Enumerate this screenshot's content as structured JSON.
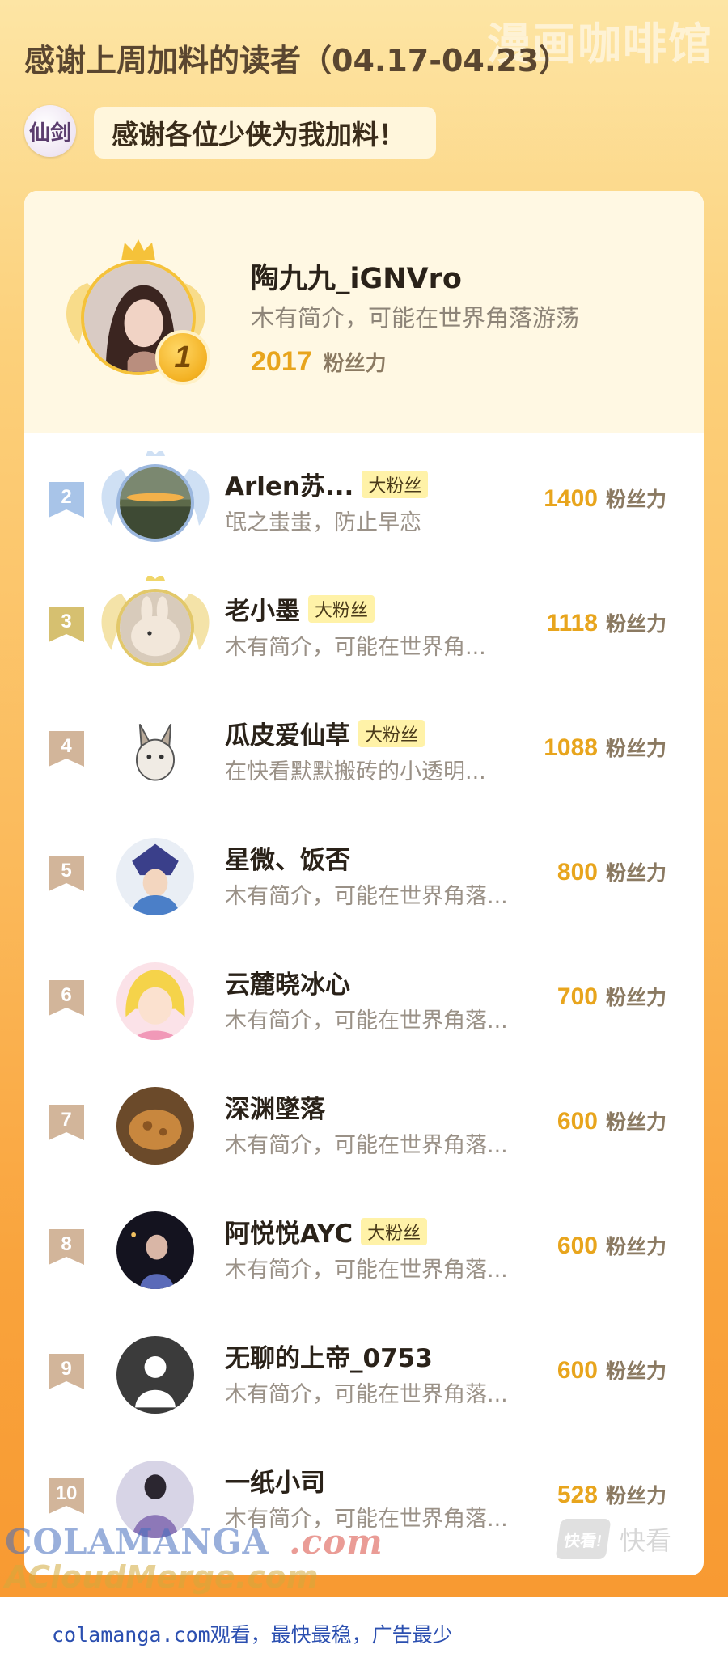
{
  "header": {
    "watermark": "漫画咖啡馆",
    "title": "感谢上周加料的读者（04.17-04.23）",
    "greeting": "感谢各位少侠为我加料！",
    "logo_text": "仙剑"
  },
  "top_reader": {
    "rank": "1",
    "name": "陶九九_iGNVro",
    "intro": "木有简介，可能在世界角落游荡",
    "score": "2017",
    "unit": "粉丝力"
  },
  "readers": [
    {
      "rank": "2",
      "name": "Arlen苏...",
      "badge": "大粉丝",
      "intro": "氓之蚩蚩，防止早恋",
      "score": "1400",
      "unit": "粉丝力"
    },
    {
      "rank": "3",
      "name": "老小墨",
      "badge": "大粉丝",
      "intro": "木有简介，可能在世界角...",
      "score": "1118",
      "unit": "粉丝力"
    },
    {
      "rank": "4",
      "name": "瓜皮爱仙草",
      "badge": "大粉丝",
      "intro": "在快看默默搬砖的小透明...",
      "score": "1088",
      "unit": "粉丝力"
    },
    {
      "rank": "5",
      "name": "星微、饭否",
      "badge": "",
      "intro": "木有简介，可能在世界角落...",
      "score": "800",
      "unit": "粉丝力"
    },
    {
      "rank": "6",
      "name": "云麓晓冰心",
      "badge": "",
      "intro": "木有简介，可能在世界角落...",
      "score": "700",
      "unit": "粉丝力"
    },
    {
      "rank": "7",
      "name": "深渊墜落",
      "badge": "",
      "intro": "木有简介，可能在世界角落...",
      "score": "600",
      "unit": "粉丝力"
    },
    {
      "rank": "8",
      "name": "阿悦悦AYC",
      "badge": "大粉丝",
      "intro": "木有简介，可能在世界角落...",
      "score": "600",
      "unit": "粉丝力"
    },
    {
      "rank": "9",
      "name": "无聊的上帝_0753",
      "badge": "",
      "intro": "木有简介，可能在世界角落...",
      "score": "600",
      "unit": "粉丝力"
    },
    {
      "rank": "10",
      "name": "一纸小司",
      "badge": "",
      "intro": "木有简介，可能在世界角落...",
      "score": "528",
      "unit": "粉丝力"
    }
  ],
  "brand": {
    "mark": "快看!",
    "word": "快看"
  },
  "watermarks": {
    "colamanga_a": "COLAMANGA",
    "colamanga_b": ".com",
    "acloud": "ACloudMerge.com"
  },
  "footer": "colamanga.com观看，最快最稳，广告最少",
  "colors": {
    "accent": "#e8a51d",
    "gold": "#f3b122",
    "silver": "#a8c4e8",
    "bronze": "#d6c070",
    "tag_default": "#d2b59a"
  }
}
